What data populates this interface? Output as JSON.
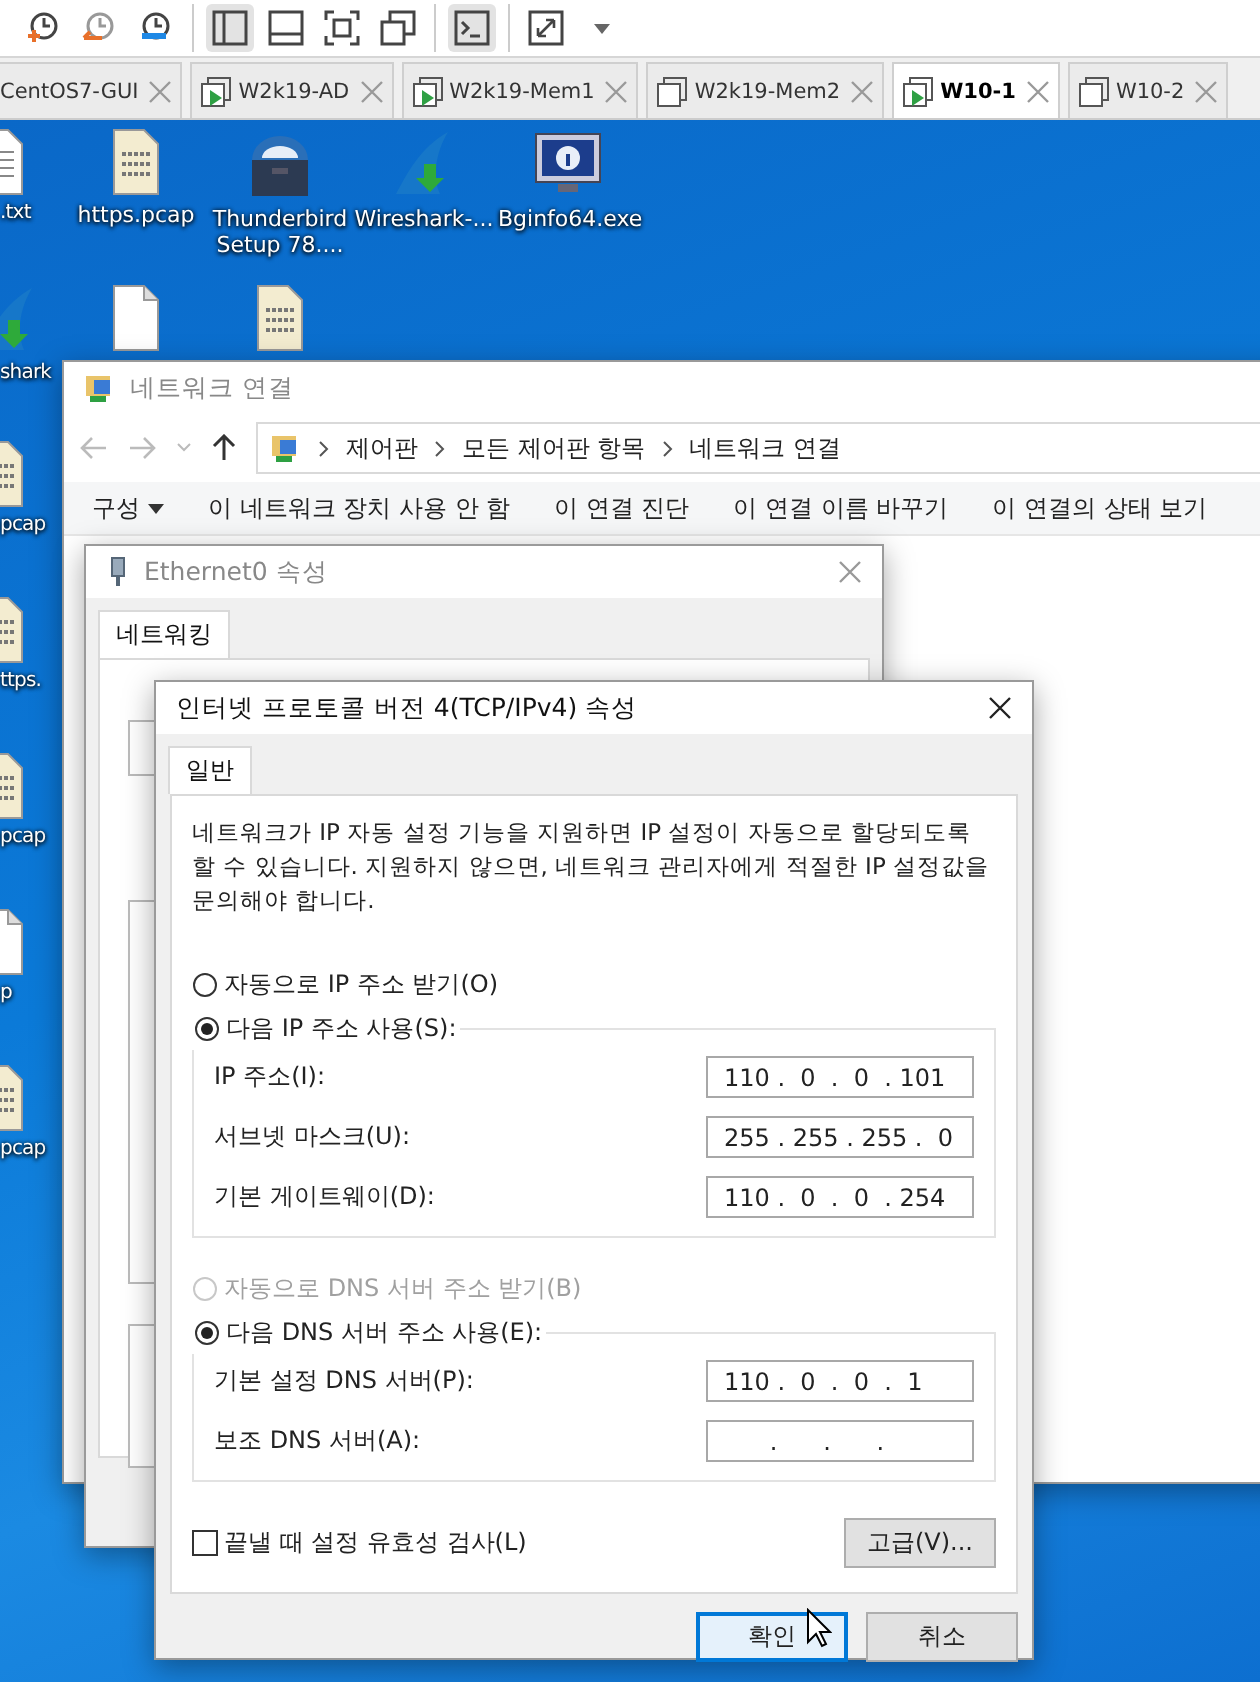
{
  "toolbar": {
    "groups": [
      [
        {
          "kind": "clock-add",
          "selected": false
        },
        {
          "kind": "clock-back",
          "selected": false
        },
        {
          "kind": "clock-wrench",
          "selected": false
        }
      ],
      [
        {
          "kind": "split-left",
          "selected": true
        },
        {
          "kind": "split-bottom",
          "selected": false
        },
        {
          "kind": "fit-screen",
          "selected": false
        },
        {
          "kind": "windows",
          "selected": false
        }
      ],
      [
        {
          "kind": "console",
          "selected": true
        }
      ],
      [
        {
          "kind": "stretch",
          "selected": false
        },
        {
          "kind": "caret",
          "selected": false
        }
      ]
    ]
  },
  "vm_tabs": [
    {
      "label": "CentOS7-GUI",
      "selected": false
    },
    {
      "label": "W2k19-AD",
      "running": true,
      "selected": false
    },
    {
      "label": "W2k19-Mem1",
      "running": true,
      "selected": false
    },
    {
      "label": "W2k19-Mem2",
      "running": false,
      "selected": false
    },
    {
      "label": "W10-1",
      "running": true,
      "selected": true
    },
    {
      "label": "W10-2",
      "running": false,
      "selected": false
    }
  ],
  "desktop": {
    "icons": [
      {
        "kind": "text-file",
        "label": ".txt"
      },
      {
        "kind": "pcap-file",
        "label": "https.pcap"
      },
      {
        "kind": "installer",
        "label": "Thunderbird Setup 78...."
      },
      {
        "kind": "wireshark",
        "label": "Wireshark-..."
      },
      {
        "kind": "info-monitor",
        "label": "Bginfo64.exe"
      },
      {
        "kind": "wireshark",
        "label": "shark"
      },
      {
        "kind": "blank-file"
      },
      {
        "kind": "pcap-file"
      },
      {
        "kind": "pcap-file",
        "label": "pcap"
      },
      {
        "kind": "pcap-file",
        "label": "ttps."
      },
      {
        "kind": "pcap-file",
        "label": "pcap"
      },
      {
        "kind": "blank-file",
        "label": "p"
      },
      {
        "kind": "pcap-file",
        "label": "pcap"
      }
    ]
  },
  "network_window": {
    "title": "네트워크 연결",
    "breadcrumbs": [
      "제어판",
      "모든 제어판 항목",
      "네트워크 연결"
    ],
    "commands": [
      {
        "label": "구성",
        "dropdown": true
      },
      {
        "label": "이 네트워크 장치 사용 안 함",
        "dropdown": false
      },
      {
        "label": "이 연결 진단",
        "dropdown": false
      },
      {
        "label": "이 연결 이름 바꾸기",
        "dropdown": false
      },
      {
        "label": "이 연결의 상태 보기",
        "dropdown": false
      }
    ]
  },
  "ethernet_dialog": {
    "title": "Ethernet0 속성",
    "tabs": [
      {
        "label": "네트워킹",
        "selected": true
      }
    ]
  },
  "tcp_dialog": {
    "title": "인터넷 프로토콜 버전 4(TCP/IPv4) 속성",
    "tabs": [
      {
        "label": "일반",
        "selected": true
      }
    ],
    "description": "네트워크가 IP 자동 설정 기능을 지원하면 IP 설정이 자동으로 할당되도록 할 수 있습니다. 지원하지 않으면, 네트워크 관리자에게 적절한 IP 설정값을 문의해야 합니다.",
    "ip_options": [
      {
        "label": "자동으로 IP 주소 받기(O)",
        "selected": false,
        "disabled": false
      },
      {
        "label": "다음 IP 주소 사용(S):",
        "selected": true,
        "disabled": false
      }
    ],
    "ip_fields": [
      {
        "label": "IP 주소(I):",
        "value": "110 .  0  .  0  . 101"
      },
      {
        "label": "서브넷 마스크(U):",
        "value": "255 . 255 . 255 .  0"
      },
      {
        "label": "기본 게이트웨이(D):",
        "value": "110 .  0  .  0  . 254"
      }
    ],
    "dns_options": [
      {
        "label": "자동으로 DNS 서버 주소 받기(B)",
        "selected": false,
        "disabled": true
      },
      {
        "label": "다음 DNS 서버 주소 사용(E):",
        "selected": true,
        "disabled": false
      }
    ],
    "dns_fields": [
      {
        "label": "기본 설정 DNS 서버(P):",
        "value": "110 .  0  .  0  .  1"
      },
      {
        "label": "보조 DNS 서버(A):",
        "value": "      .      .      ."
      }
    ],
    "validate": {
      "label": "끝낼 때 설정 유효성 검사(L)",
      "checked": false
    },
    "advanced_button": "고급(V)...",
    "buttons": [
      {
        "label": "확인",
        "default": true
      },
      {
        "label": "취소",
        "default": false
      }
    ]
  }
}
